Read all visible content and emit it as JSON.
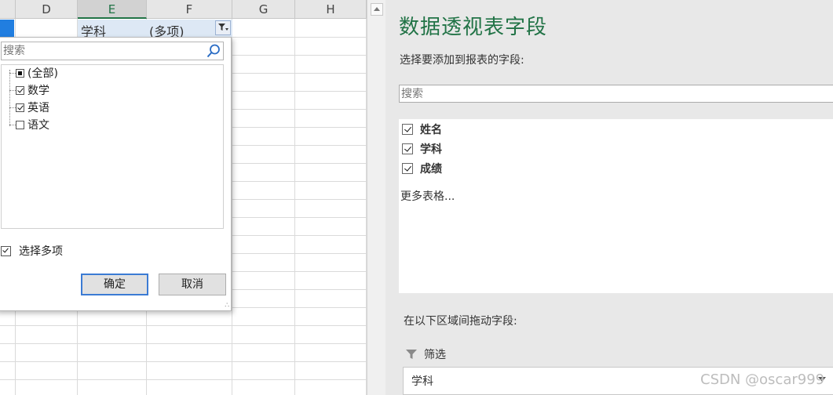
{
  "sheet": {
    "columns": [
      "D",
      "E",
      "F",
      "G",
      "H"
    ],
    "cells": {
      "e1": "学科",
      "f1": "(多项)"
    }
  },
  "filter_dropdown": {
    "search_placeholder": "搜索",
    "items": [
      {
        "label": "(全部)",
        "state": "partial"
      },
      {
        "label": "数学",
        "state": "checked"
      },
      {
        "label": "英语",
        "state": "checked"
      },
      {
        "label": "语文",
        "state": "unchecked"
      }
    ],
    "multi_select_label": "选择多项",
    "multi_select_checked": true,
    "ok_label": "确定",
    "cancel_label": "取消"
  },
  "pivot_pane": {
    "title": "数据透视表字段",
    "subtitle": "选择要添加到报表的字段:",
    "search_placeholder": "搜索",
    "fields": [
      {
        "label": "姓名",
        "checked": true
      },
      {
        "label": "学科",
        "checked": true
      },
      {
        "label": "成绩",
        "checked": true
      }
    ],
    "more_tables": "更多表格...",
    "drag_hint": "在以下区域间拖动字段:",
    "filter_area_label": "筛选",
    "filter_field": "学科"
  },
  "watermark": "CSDN @oscar999",
  "colors": {
    "accent_green": "#217346",
    "selection_blue": "#217ee0",
    "ok_border": "#3b7bd4"
  }
}
